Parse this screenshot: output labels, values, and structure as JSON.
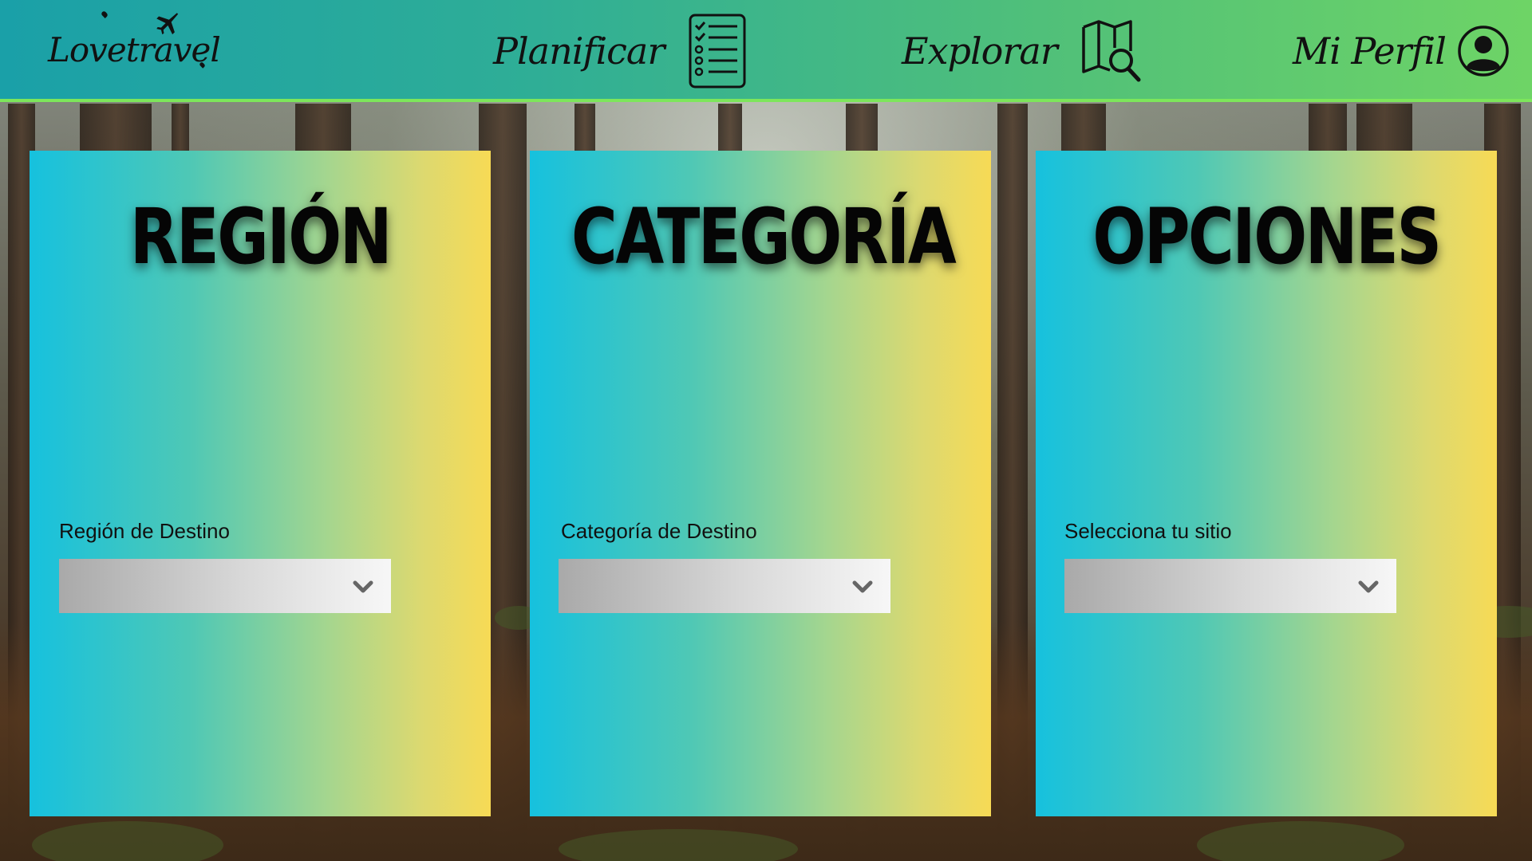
{
  "header": {
    "brand": "Lovetravel",
    "nav": [
      {
        "label": "Planificar",
        "icon": "checklist-icon"
      },
      {
        "label": "Explorar",
        "icon": "map-search-icon"
      },
      {
        "label": "Mi Perfil",
        "icon": "user-circle-icon"
      }
    ]
  },
  "cards": [
    {
      "title": "REGIÓN",
      "field_label": "Región de Destino",
      "select_value": ""
    },
    {
      "title": "CATEGORÍA",
      "field_label": "Categoría de Destino",
      "select_value": ""
    },
    {
      "title": "OPCIONES",
      "field_label": "Selecciona tu sitio",
      "select_value": ""
    }
  ],
  "colors": {
    "header_gradient_start": "#1aa0a8",
    "header_gradient_end": "#6ed466",
    "card_gradient_start": "#16c1de",
    "card_gradient_end": "#f7da55",
    "header_border": "#7de65b"
  }
}
